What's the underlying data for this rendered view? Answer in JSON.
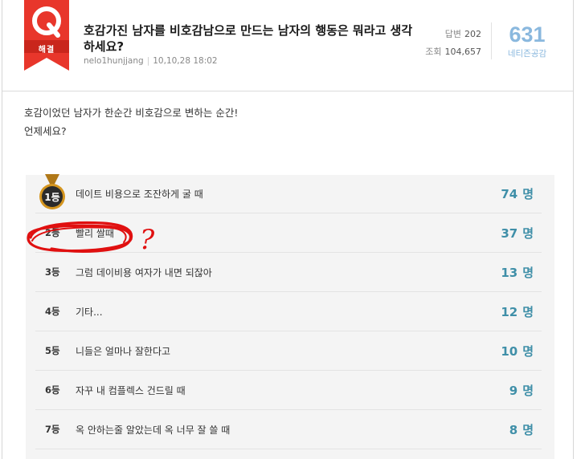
{
  "question": {
    "badge_letter": "Q",
    "badge_status": "해결",
    "title": "호감가진 남자를 비호감남으로 만드는 남자의 행동은 뭐라고 생각하세요?",
    "author": "nelo1hunjjang",
    "date": "10,10,28 18:02",
    "answers_label": "답변",
    "answers_count": "202",
    "views_label": "조회",
    "views_count": "104,657",
    "empathy_count": "631",
    "empathy_label": "네티즌공감"
  },
  "body": {
    "line1": "호감이었던 남자가 한순간 비호감으로 변하는 순간!",
    "line2": "언제세요?"
  },
  "poll": {
    "unit": "명",
    "items": [
      {
        "rank": "1등",
        "text": "데이트 비용으로 조잔하게 굴 때",
        "votes": "74"
      },
      {
        "rank": "2등",
        "text": "빨리 쌀때",
        "votes": "37"
      },
      {
        "rank": "3등",
        "text": "그럼 데이비용 여자가 내면 되잖아",
        "votes": "13"
      },
      {
        "rank": "4등",
        "text": "기타...",
        "votes": "12"
      },
      {
        "rank": "5등",
        "text": "니들은 얼마나 잘한다고",
        "votes": "10"
      },
      {
        "rank": "6등",
        "text": "자꾸 내 컴플렉스 건드릴 때",
        "votes": "9"
      },
      {
        "rank": "7등",
        "text": "옥 안하는줄 알았는데 옥 너무 잘 쓸 때",
        "votes": "8"
      }
    ]
  },
  "annotation": {
    "mark": "?",
    "color": "#e01010"
  },
  "colors": {
    "badge_red": "#e8362b",
    "vote_blue": "#3f8fa8",
    "empathy_blue": "#8ab8de",
    "medal_gold": "#c68a1a"
  }
}
